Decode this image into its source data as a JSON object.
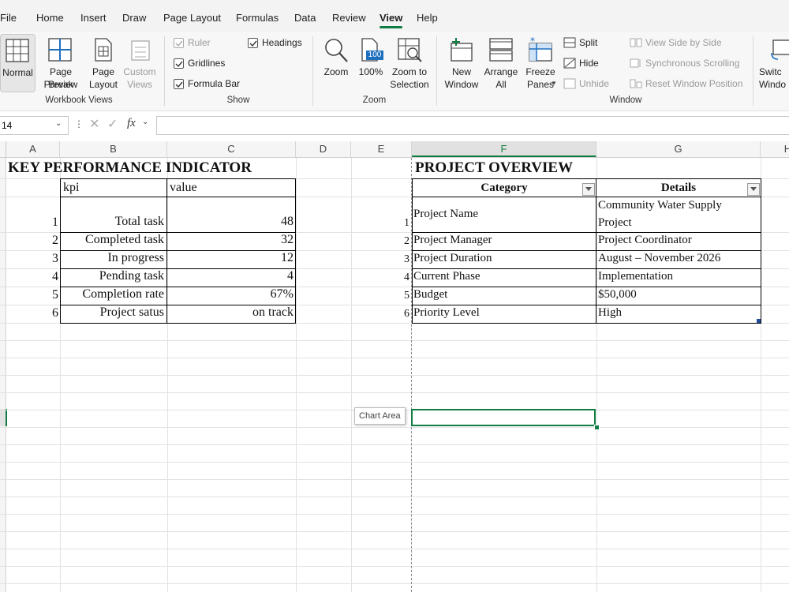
{
  "menu": {
    "items": [
      "File",
      "Home",
      "Insert",
      "Draw",
      "Page Layout",
      "Formulas",
      "Data",
      "Review",
      "View",
      "Help"
    ],
    "active": "View"
  },
  "ribbon": {
    "workbook_views": {
      "label": "Workbook Views",
      "normal": "Normal",
      "page_break_1": "Page Break",
      "page_break_2": "Preview",
      "page_layout_1": "Page",
      "page_layout_2": "Layout",
      "custom_1": "Custom",
      "custom_2": "Views"
    },
    "show": {
      "label": "Show",
      "ruler": "Ruler",
      "gridlines": "Gridlines",
      "formula_bar": "Formula Bar",
      "headings": "Headings"
    },
    "zoom": {
      "label": "Zoom",
      "zoom": "Zoom",
      "hundred": "100%",
      "badge": "100",
      "zoom_sel_1": "Zoom to",
      "zoom_sel_2": "Selection"
    },
    "window": {
      "label": "Window",
      "new_1": "New",
      "new_2": "Window",
      "arrange_1": "Arrange",
      "arrange_2": "All",
      "freeze_1": "Freeze",
      "freeze_2": "Panes",
      "split": "Split",
      "hide": "Hide",
      "unhide": "Unhide",
      "view_side": "View Side by Side",
      "sync_scroll": "Synchronous Scrolling",
      "reset_pos": "Reset Window Position",
      "switch_1": "Switc",
      "switch_2": "Windo"
    }
  },
  "formula_bar": {
    "name_box": "14",
    "fx": "fx",
    "content": ""
  },
  "columns": [
    "A",
    "B",
    "C",
    "D",
    "E",
    "F",
    "G",
    "H"
  ],
  "kpi": {
    "title": "KEY PERFORMANCE INDICATOR",
    "header_kpi": "kpi",
    "header_value": "value",
    "rows": [
      {
        "n": "1",
        "kpi": "Total task",
        "value": "48"
      },
      {
        "n": "2",
        "kpi": "Completed task",
        "value": "32"
      },
      {
        "n": "3",
        "kpi": "In progress",
        "value": "12"
      },
      {
        "n": "4",
        "kpi": "Pending task",
        "value": "4"
      },
      {
        "n": "5",
        "kpi": "Completion rate",
        "value": "67%"
      },
      {
        "n": "6",
        "kpi": "Project satus",
        "value": "on track"
      }
    ]
  },
  "overview": {
    "title": "PROJECT OVERVIEW",
    "header_category": "Category",
    "header_details": "Details",
    "rows": [
      {
        "n": "1",
        "category": "Project Name",
        "details_1": "Community Water Supply",
        "details_2": "Project"
      },
      {
        "n": "2",
        "category": "Project Manager",
        "details_1": "Project Coordinator"
      },
      {
        "n": "3",
        "category": "Project Duration",
        "details_1": "August – November 2026"
      },
      {
        "n": "4",
        "category": "Current Phase",
        "details_1": "Implementation"
      },
      {
        "n": "5",
        "category": "Budget",
        "details_1": "$50,000"
      },
      {
        "n": "6",
        "category": "Priority Level",
        "details_1": "High"
      }
    ]
  },
  "tooltip": "Chart Area",
  "colors": {
    "accent": "#107c41"
  }
}
